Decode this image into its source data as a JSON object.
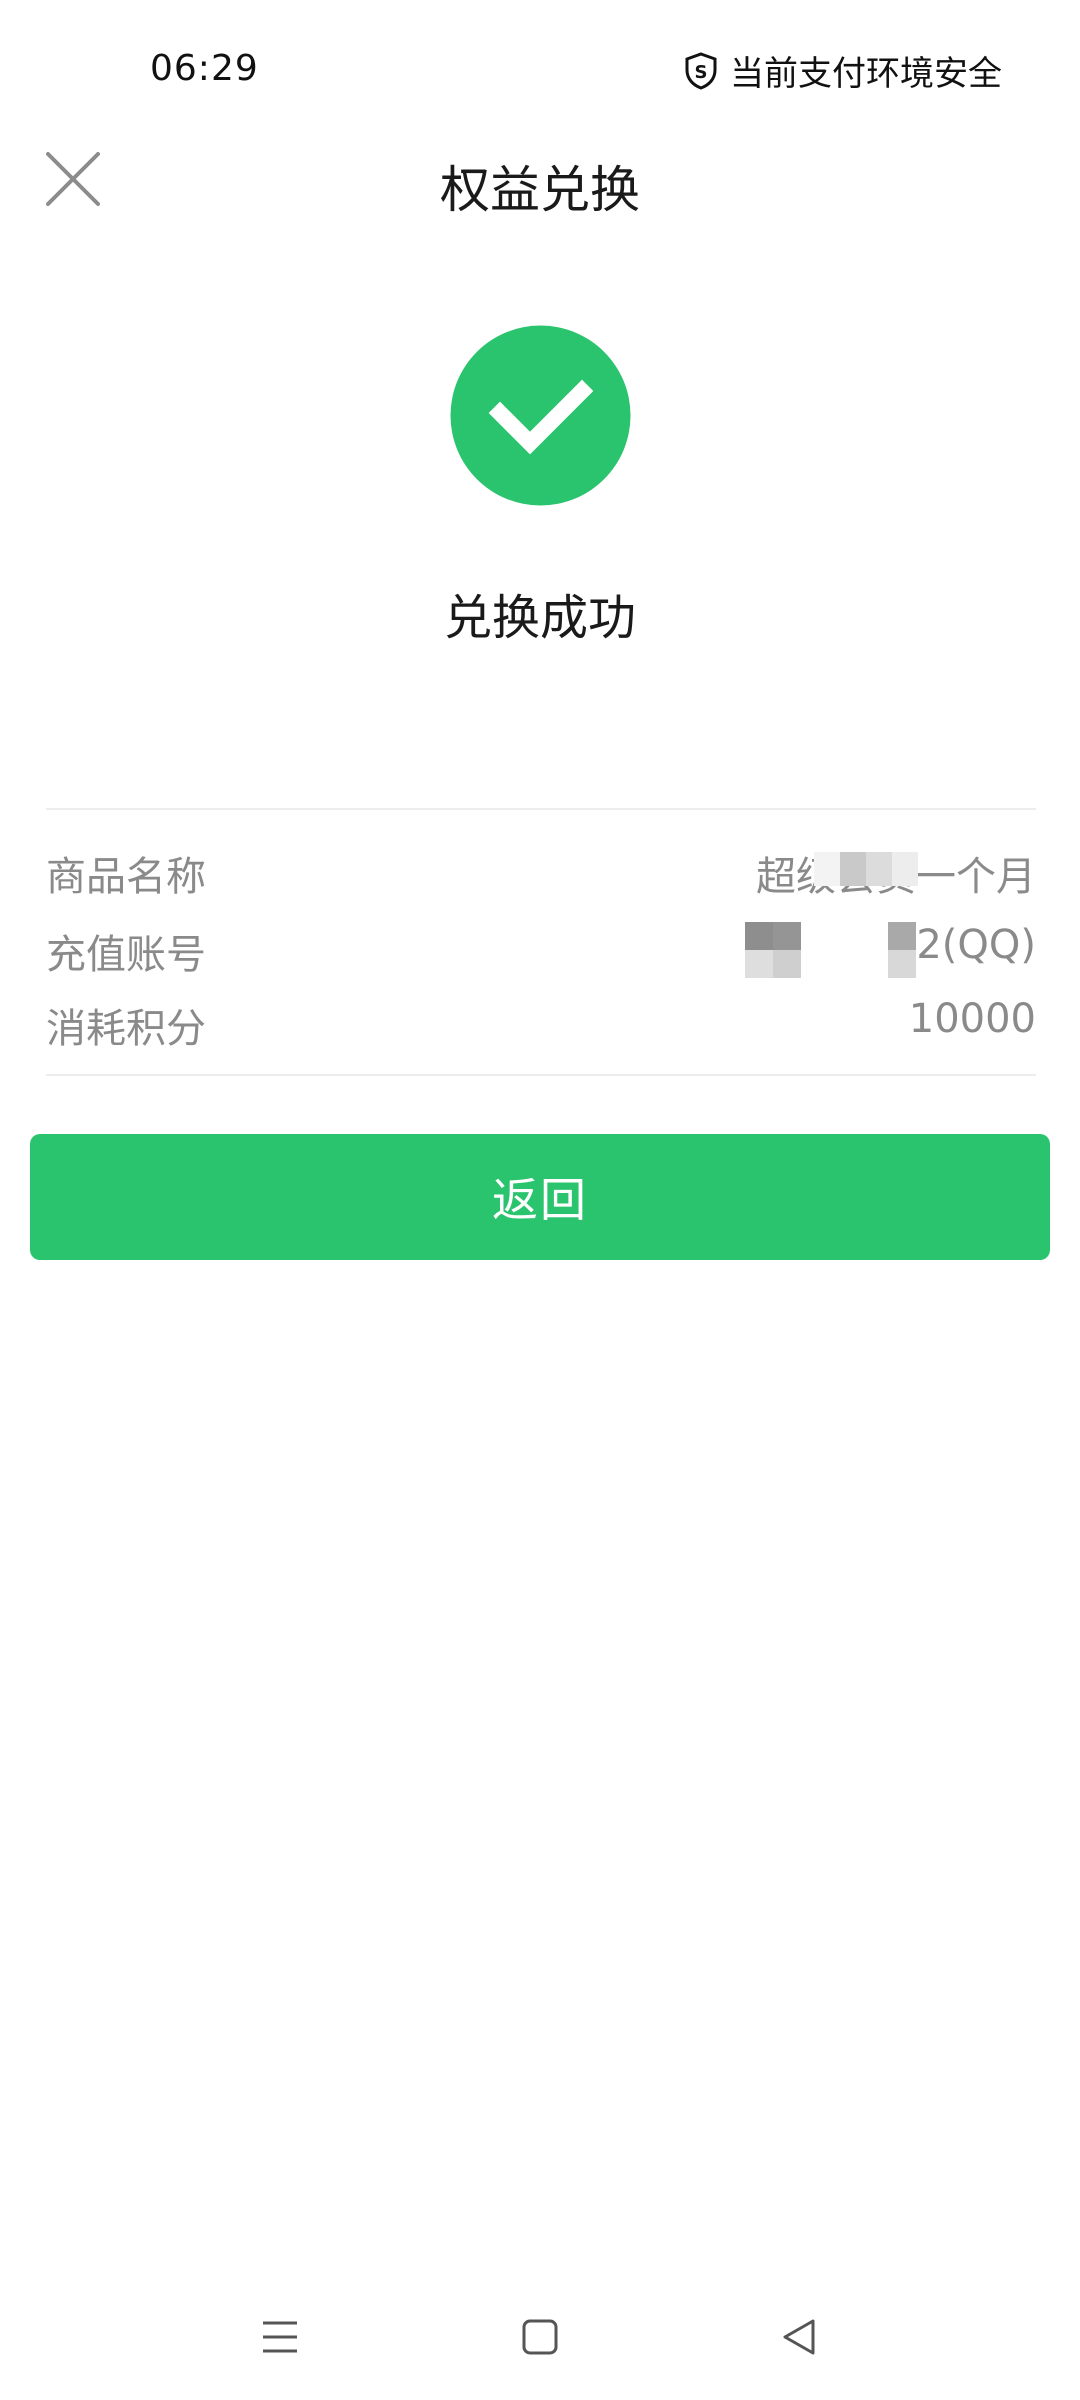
{
  "status_bar": {
    "time": "06:29",
    "security_text": "当前支付环境安全",
    "security_icon": "shield-s-icon"
  },
  "header": {
    "title": "权益兑换",
    "close_icon": "close-icon"
  },
  "result": {
    "icon": "check-circle-icon",
    "icon_color": "#2bc46e",
    "text": "兑换成功"
  },
  "details": {
    "rows": [
      {
        "label": "商品名称",
        "value": "超级会员一个月"
      },
      {
        "label": "充值账号",
        "value": "2(QQ)"
      },
      {
        "label": "消耗积分",
        "value": "10000"
      }
    ]
  },
  "actions": {
    "return_label": "返回",
    "button_color": "#2bc46e"
  },
  "nav_bar": {
    "icons": [
      "menu-icon",
      "home-square-icon",
      "back-triangle-icon"
    ]
  }
}
